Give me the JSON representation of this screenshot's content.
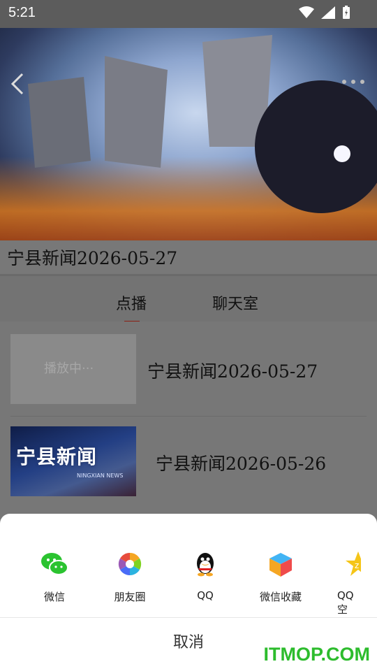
{
  "status": {
    "time": "5:21"
  },
  "video": {
    "title": "宁县新闻2026-05-27"
  },
  "tabs": [
    {
      "label": "点播"
    },
    {
      "label": "聊天室"
    }
  ],
  "list": [
    {
      "title": "宁县新闻2026-05-27",
      "thumb_text": "播放中···"
    },
    {
      "title": "宁县新闻2026-05-26",
      "thumb_logo": "宁县新闻",
      "thumb_logo_small": "NINGXIAN NEWS"
    }
  ],
  "share": [
    {
      "label": "微信",
      "icon": "wechat-icon"
    },
    {
      "label": "朋友圈",
      "icon": "moments-icon"
    },
    {
      "label": "QQ",
      "icon": "qq-icon"
    },
    {
      "label": "微信收藏",
      "icon": "wechat-favorites-icon"
    },
    {
      "label": "QQ空",
      "icon": "qzone-icon"
    }
  ],
  "cancel_label": "取消",
  "watermark": "ITMOP.COM",
  "colors": {
    "accent": "#8a1f14",
    "watermark": "#2dbc2d"
  }
}
